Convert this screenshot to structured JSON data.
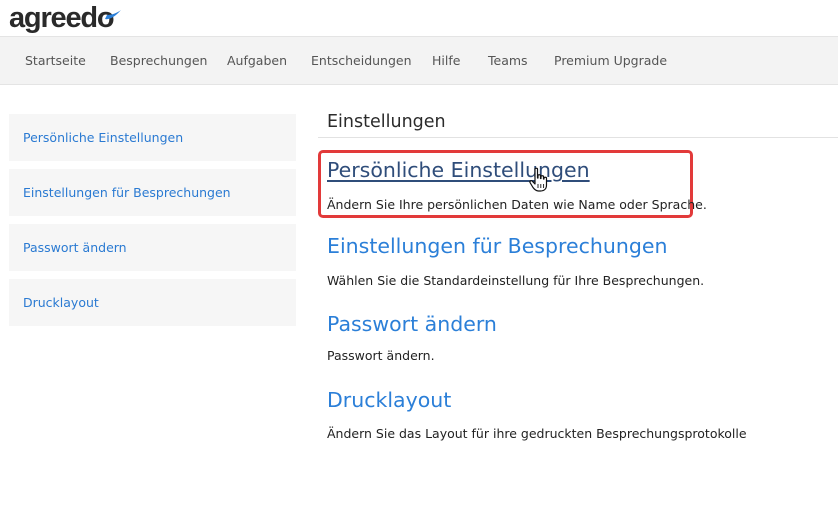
{
  "app": {
    "logo_text": "agreedo"
  },
  "nav": {
    "items": [
      {
        "label": "Startseite"
      },
      {
        "label": "Besprechungen"
      },
      {
        "label": "Aufgaben"
      },
      {
        "label": "Entscheidungen"
      },
      {
        "label": "Hilfe"
      },
      {
        "label": "Teams"
      },
      {
        "label": "Premium Upgrade"
      }
    ]
  },
  "sidebar": {
    "items": [
      {
        "label": "Persönliche Einstellungen"
      },
      {
        "label": "Einstellungen für Besprechungen"
      },
      {
        "label": "Passwort ändern"
      },
      {
        "label": "Drucklayout"
      }
    ]
  },
  "main": {
    "title": "Einstellungen",
    "sections": [
      {
        "title": "Persönliche Einstellungen",
        "description": "Ändern Sie Ihre persönlichen Daten wie Name oder Sprache."
      },
      {
        "title": "Einstellungen für Besprechungen",
        "description": "Wählen Sie die Standardeinstellung für Ihre Besprechungen."
      },
      {
        "title": "Passwort ändern",
        "description": "Passwort ändern."
      },
      {
        "title": "Drucklayout",
        "description": "Ändern Sie das Layout für ihre gedruckten Besprechungsprotokolle"
      }
    ]
  },
  "colors": {
    "link": "#2b7fd8",
    "active_link": "#2f4d7a",
    "highlight": "#e23a3a",
    "nav_bg": "#f3f3f3",
    "sidebar_bg": "#f6f6f6"
  },
  "icons": {
    "logo_mark": "swoosh-icon",
    "pointer": "hand-cursor-icon"
  }
}
